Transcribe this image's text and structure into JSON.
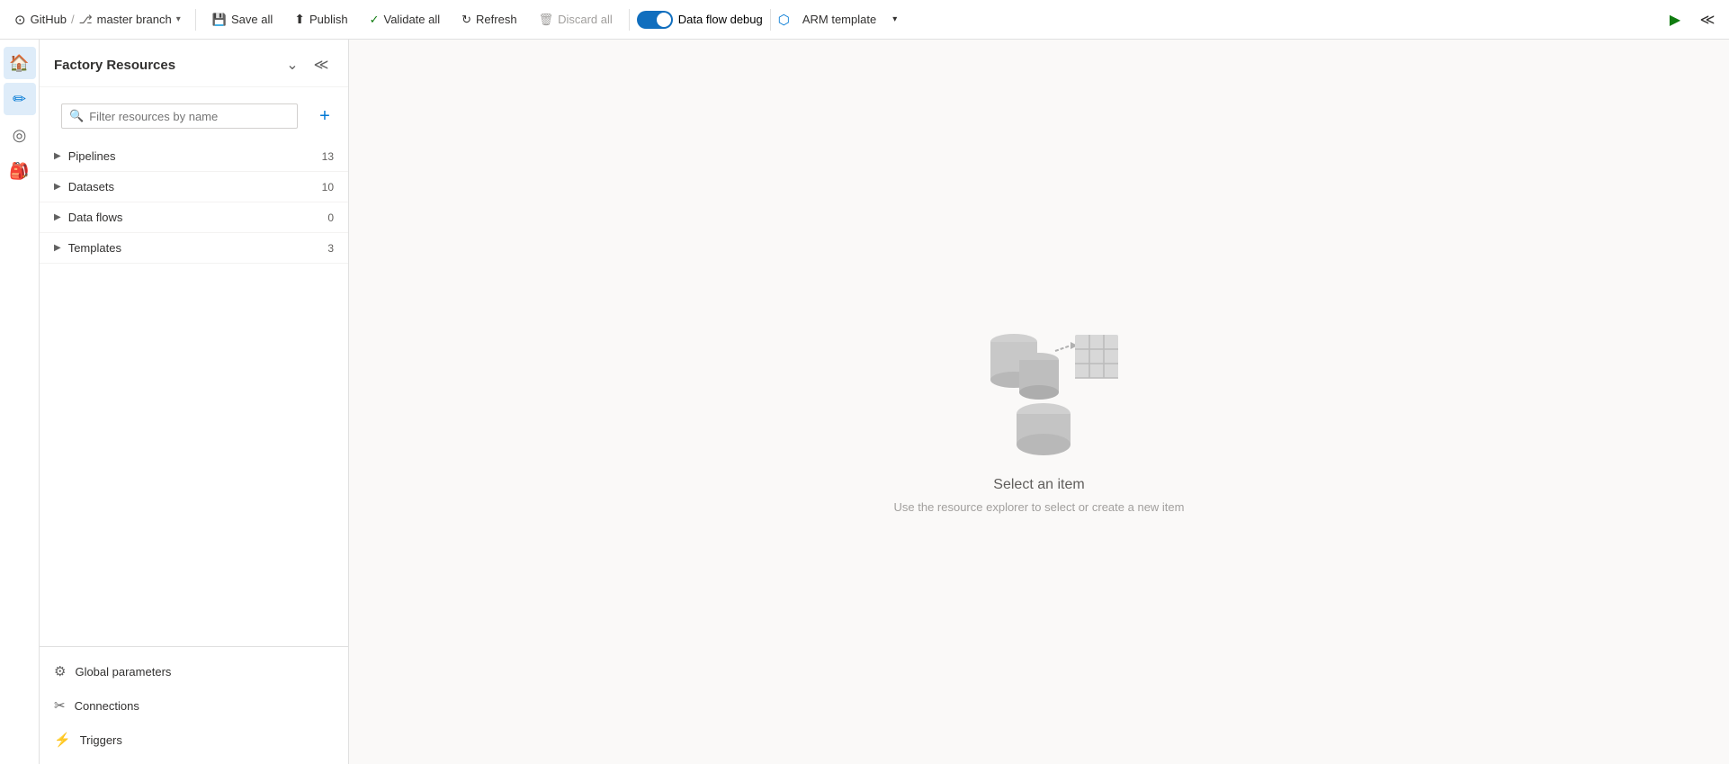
{
  "topbar": {
    "github_label": "GitHub",
    "branch_label": "master branch",
    "save_all_label": "Save all",
    "publish_label": "Publish",
    "validate_all_label": "Validate all",
    "refresh_label": "Refresh",
    "discard_all_label": "Discard all",
    "data_flow_debug_label": "Data flow debug",
    "arm_template_label": "ARM template"
  },
  "sidebar": {
    "title": "Factory Resources",
    "search_placeholder": "Filter resources by name",
    "resources": [
      {
        "name": "Pipelines",
        "count": 13
      },
      {
        "name": "Datasets",
        "count": 10
      },
      {
        "name": "Data flows",
        "count": 0
      },
      {
        "name": "Templates",
        "count": 3
      }
    ],
    "bottom_items": [
      {
        "icon": "⚙",
        "label": "Global parameters"
      },
      {
        "icon": "✂",
        "label": "Connections"
      },
      {
        "icon": "⚡",
        "label": "Triggers"
      }
    ]
  },
  "main": {
    "empty_title": "Select an item",
    "empty_subtitle": "Use the resource explorer to select or create a new item"
  },
  "nav": {
    "items": [
      {
        "icon": "🏠",
        "name": "home",
        "active": true
      },
      {
        "icon": "✏",
        "name": "author",
        "active": false
      },
      {
        "icon": "◎",
        "name": "monitor",
        "active": false
      },
      {
        "icon": "🎒",
        "name": "manage",
        "active": false
      }
    ]
  }
}
